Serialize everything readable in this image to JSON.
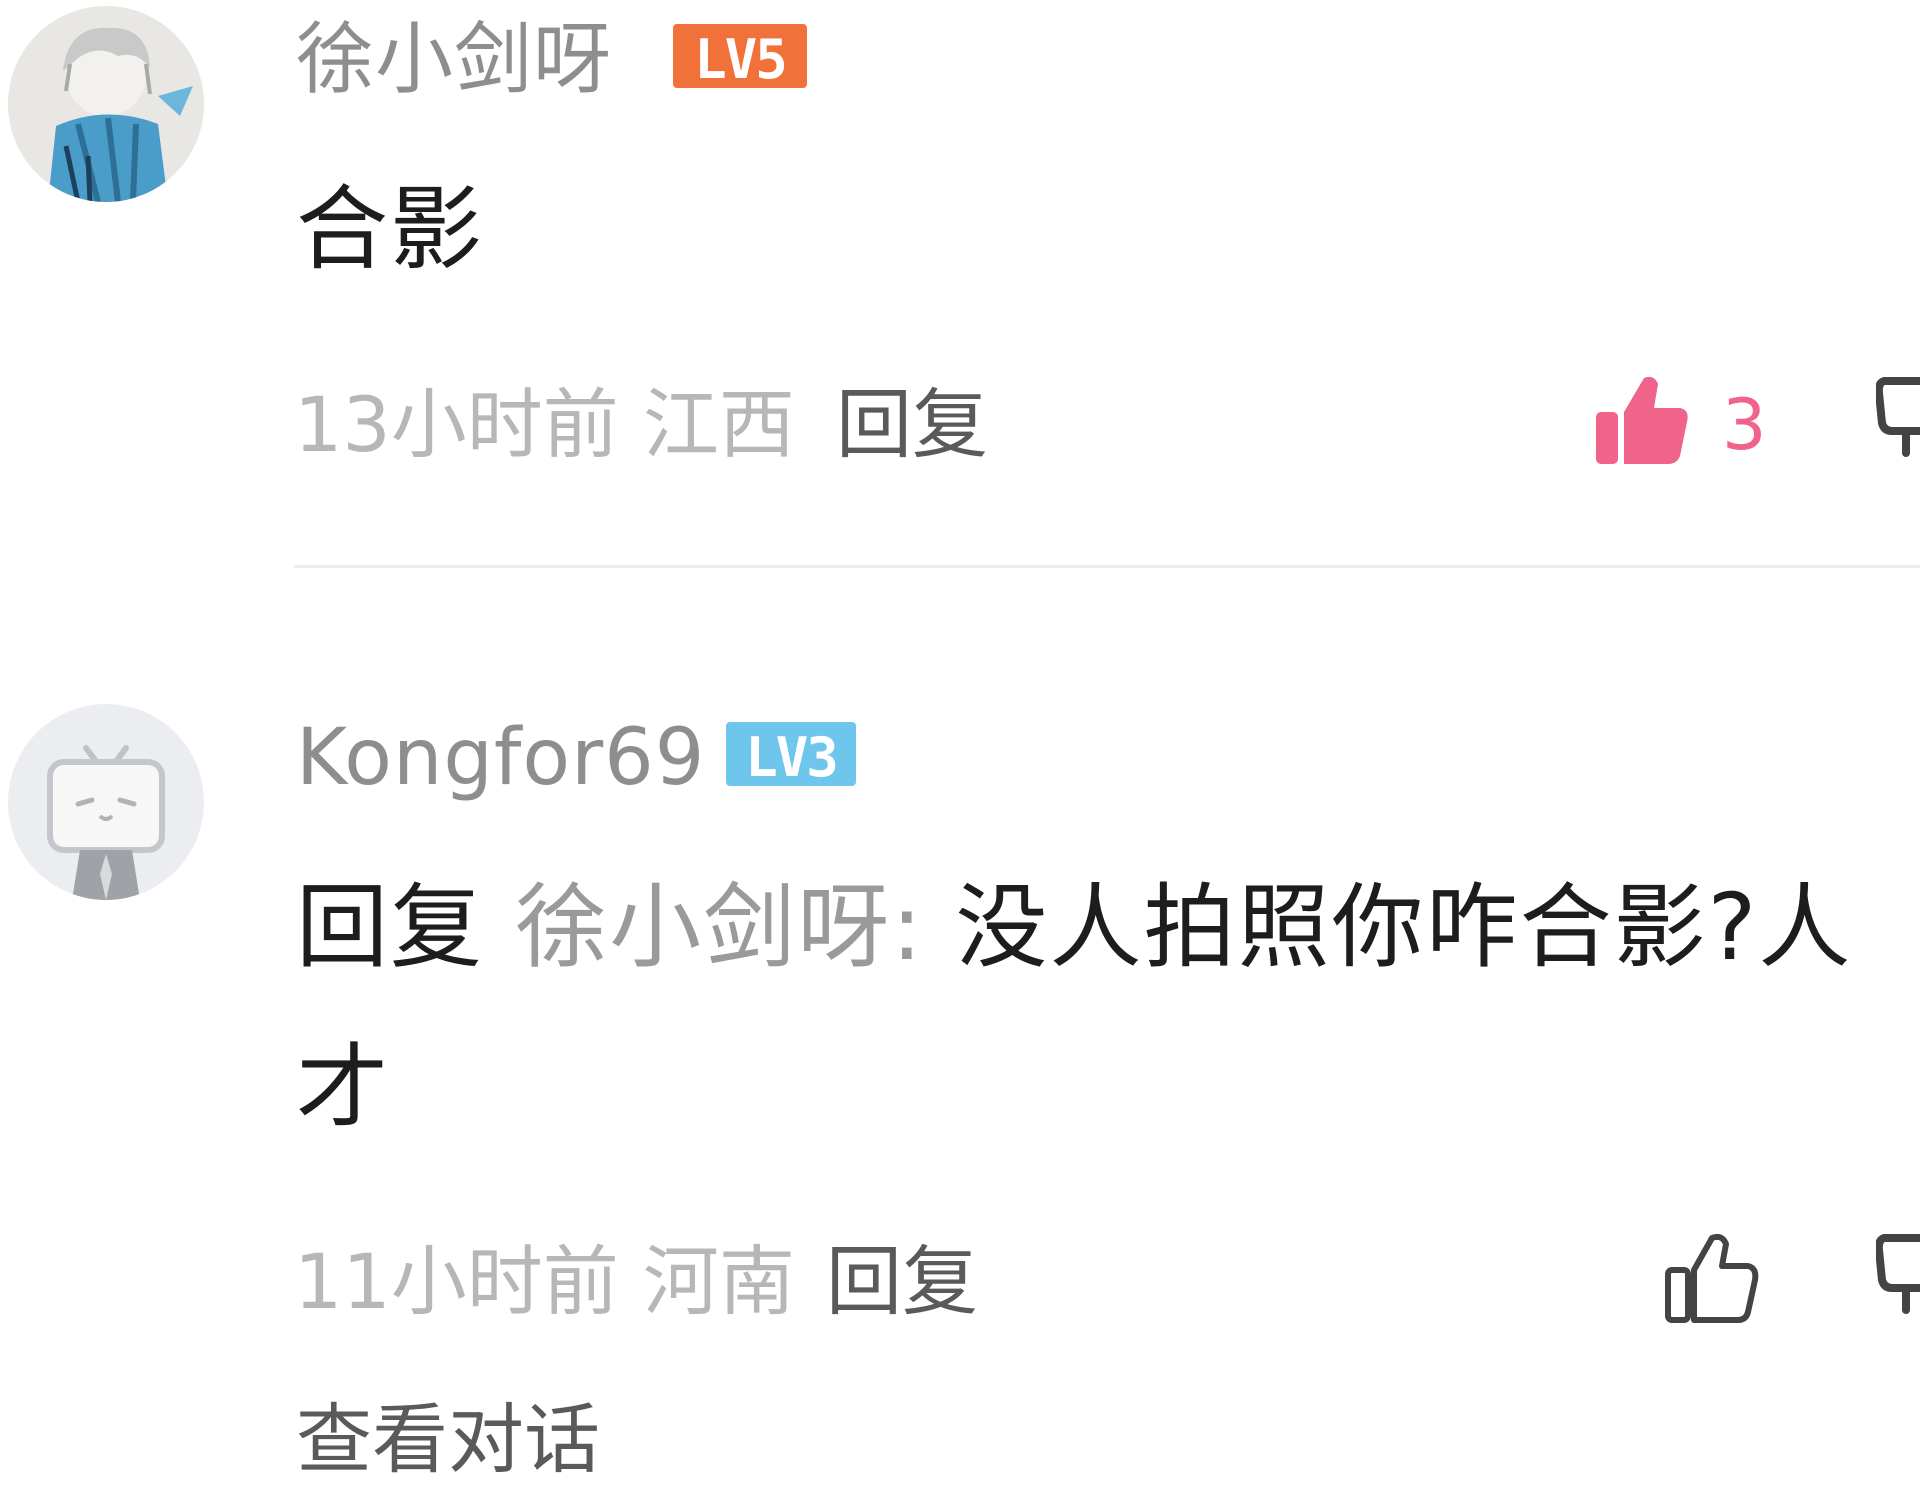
{
  "comments": [
    {
      "username": "徐小剑呀",
      "level": "LV5",
      "content": "合影",
      "time_location": "13小时前 江西",
      "reply_label": "回复",
      "like_count": "3",
      "like_active": true,
      "avatar_icon": "anime-boy-avatar"
    },
    {
      "username": "Kongfor69",
      "level": "LV3",
      "reply_prefix": "回复",
      "mention": "徐小剑呀:",
      "content": " 没人拍照你咋合影?人才",
      "time_location": "11小时前 河南",
      "reply_label": "回复",
      "like_active": false,
      "avatar_icon": "bilibili-tv-default-avatar"
    }
  ],
  "footer": {
    "view_conversation": "查看对话"
  },
  "colors": {
    "lv5": "#f07139",
    "lv3": "#6ec6ec",
    "like_active": "#f0648c",
    "muted_text": "#b7b7b7"
  }
}
